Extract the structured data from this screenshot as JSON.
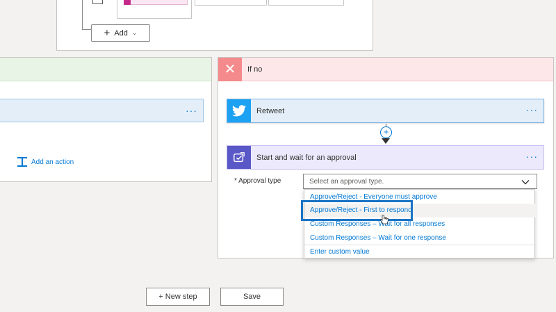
{
  "condition": {
    "add_label": "Add"
  },
  "branch_yes": {
    "add_action_label": "Add an action"
  },
  "branch_no": {
    "title": "If no",
    "retweet": {
      "title": "Retweet",
      "more": "···"
    },
    "approval": {
      "title": "Start and wait for an approval",
      "more": "···",
      "field_label": "* Approval type",
      "placeholder": "Select an approval type.",
      "options": [
        "Approve/Reject - Everyone must approve",
        "Approve/Reject - First to respond",
        "Custom Responses – Wait for all responses",
        "Custom Responses – Wait for one response",
        "Enter custom value"
      ]
    }
  },
  "footer": {
    "new_step_label": "+ New step",
    "save_label": "Save"
  },
  "colors": {
    "twitter": "#1da1f2",
    "approvals": "#5a57c7",
    "if_no": "#f48a8c",
    "accent": "#0078d4"
  }
}
